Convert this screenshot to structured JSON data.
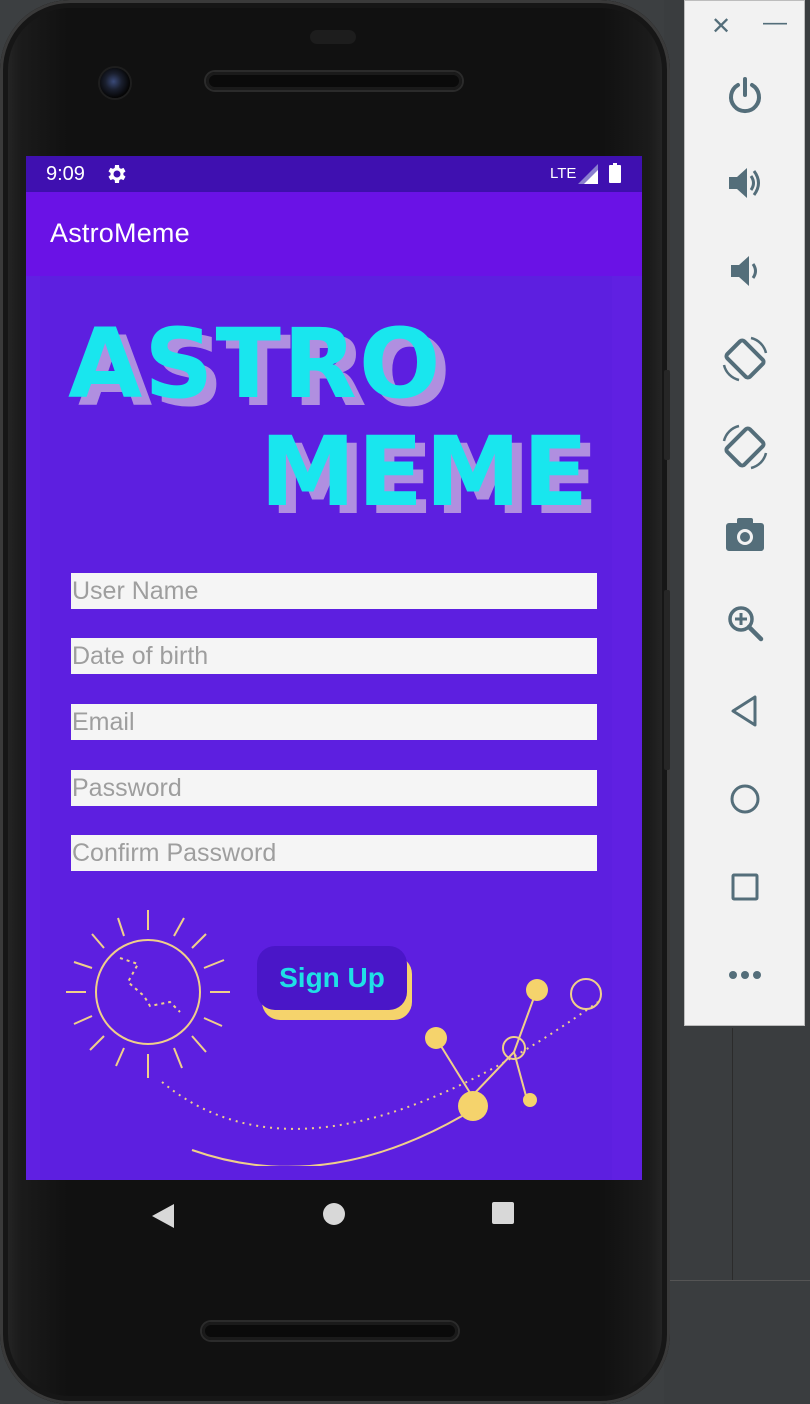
{
  "status_bar": {
    "time": "9:09",
    "network": "LTE"
  },
  "app_bar": {
    "title": "AstroMeme"
  },
  "logo": {
    "line1": "ASTRO",
    "line2": "MEME"
  },
  "form": {
    "username_placeholder": "User Name",
    "dob_placeholder": "Date of birth",
    "email_placeholder": "Email",
    "password_placeholder": "Password",
    "confirm_password_placeholder": "Confirm Password",
    "submit_label": "Sign Up"
  },
  "nav_bar": {
    "icons": [
      "back-icon",
      "home-icon",
      "recents-icon"
    ]
  },
  "emulator_panel": {
    "controls": [
      "close-icon",
      "minimize-icon"
    ],
    "buttons": [
      "power-icon",
      "volume-up-icon",
      "volume-down-icon",
      "rotate-left-icon",
      "rotate-right-icon",
      "camera-icon",
      "zoom-icon",
      "back-icon",
      "home-icon",
      "overview-icon",
      "more-icon"
    ]
  },
  "colors": {
    "screen_bg": "#6020e2",
    "app_bar": "#6a12e6",
    "status_bar": "#3f10b0",
    "logo_text": "#19e6ee",
    "button_bg": "#4a16c8",
    "button_text": "#1fe0e6",
    "accent_yellow": "#f5d36c"
  }
}
